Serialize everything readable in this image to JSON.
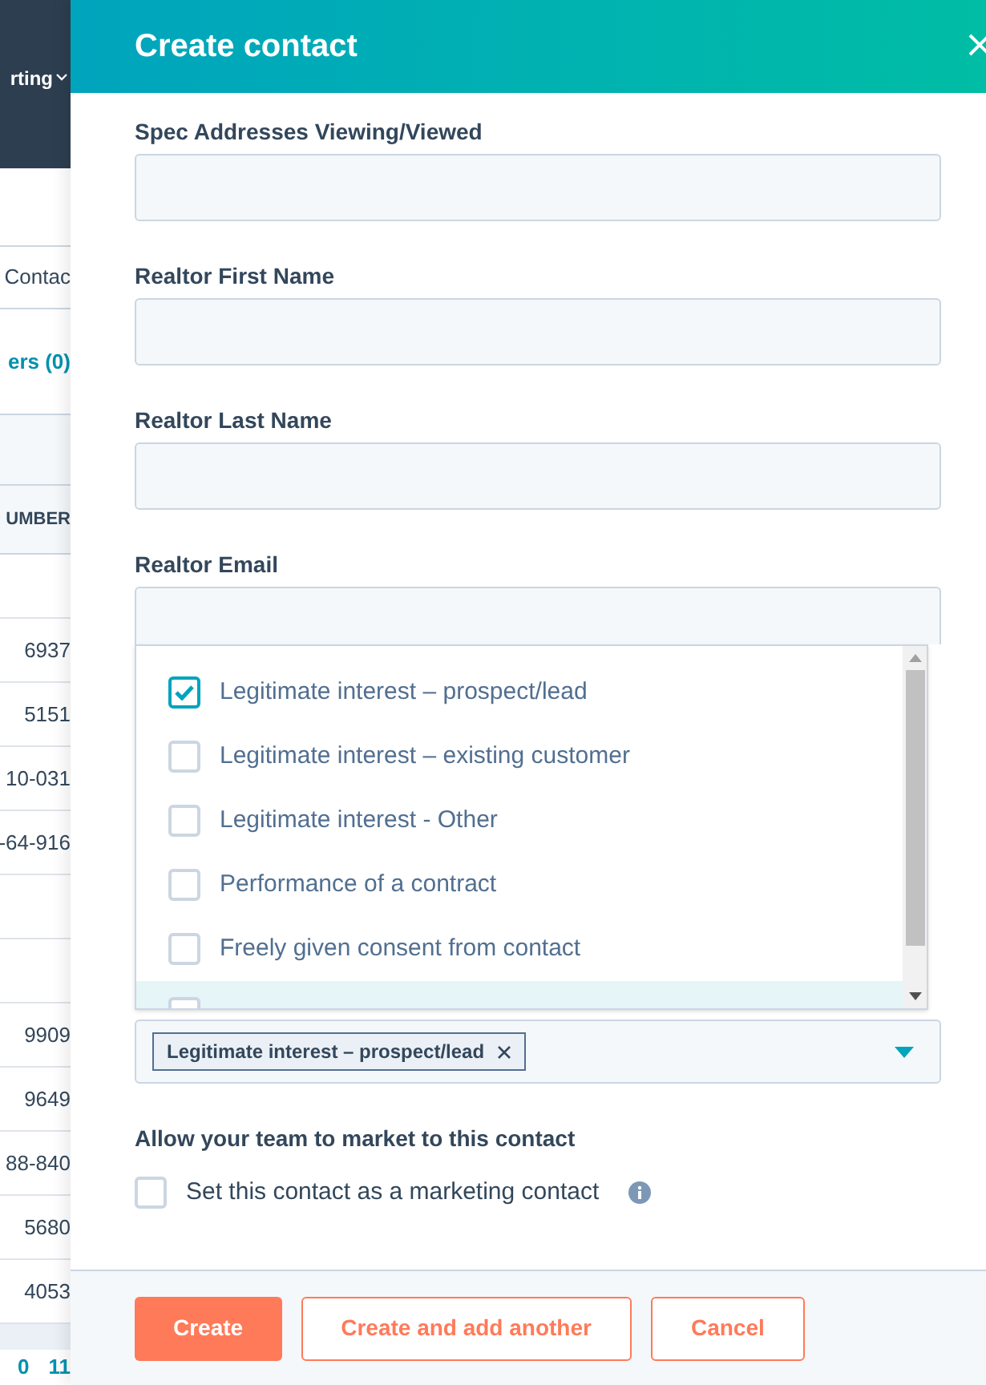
{
  "background": {
    "nav_label": "rting",
    "tab": "Contac",
    "filter": "ers (0)",
    "column": "UMBER",
    "rows": [
      "",
      "6937",
      "5151",
      "10-031",
      "-64-916",
      "",
      "",
      "9909",
      "9649",
      "88-840",
      "5680",
      "4053"
    ],
    "footer": [
      "0",
      "11"
    ]
  },
  "panel": {
    "title": "Create contact",
    "fields": [
      {
        "label": "Spec Addresses Viewing/Viewed"
      },
      {
        "label": "Realtor First Name"
      },
      {
        "label": "Realtor Last Name"
      },
      {
        "label": "Realtor Email"
      }
    ],
    "dropdown": {
      "options": [
        {
          "label": "Legitimate interest – prospect/lead",
          "checked": true,
          "highlighted": false
        },
        {
          "label": "Legitimate interest – existing customer",
          "checked": false,
          "highlighted": false
        },
        {
          "label": "Legitimate interest - Other",
          "checked": false,
          "highlighted": false
        },
        {
          "label": "Performance of a contract",
          "checked": false,
          "highlighted": false
        },
        {
          "label": "Freely given consent from contact",
          "checked": false,
          "highlighted": false
        },
        {
          "checked": false,
          "highlighted": true
        }
      ]
    },
    "select": {
      "tags": [
        "Legitimate interest – prospect/lead"
      ]
    },
    "marketing": {
      "heading": "Allow your team to market to this contact",
      "label": "Set this contact as a marketing contact",
      "checked": false
    },
    "buttons": [
      {
        "label": "Create",
        "kind": "primary"
      },
      {
        "label": "Create and add another",
        "kind": "secondary"
      },
      {
        "label": "Cancel",
        "kind": "secondary"
      }
    ]
  }
}
